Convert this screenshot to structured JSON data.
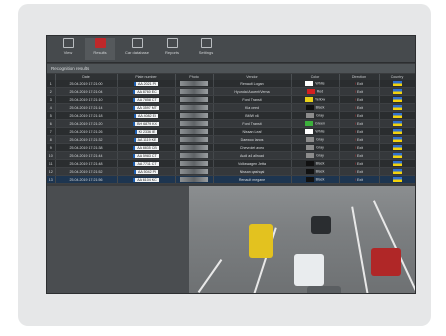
{
  "toolbar": {
    "items": [
      {
        "label": "View",
        "icon": "view-icon"
      },
      {
        "label": "Results",
        "icon": "results-icon",
        "active": true
      },
      {
        "label": "Car database",
        "icon": "car-database-icon"
      },
      {
        "label": "Reports",
        "icon": "reports-icon"
      },
      {
        "label": "Settings",
        "icon": "settings-icon"
      }
    ]
  },
  "panel": {
    "title": "Recognition results"
  },
  "table": {
    "columns": [
      "",
      "Date",
      "Plate number",
      "Photo",
      "Vendor",
      "Color",
      "Direction",
      "Country"
    ],
    "rows": [
      {
        "n": "1",
        "date": "25.04.2019 17:21:00",
        "plate": "AA 2021 PI",
        "vendor": "Renault Logan",
        "color": "White",
        "color_hex": "#ffffff",
        "dir": "Exit"
      },
      {
        "n": "2",
        "date": "25.04.2019 17:21:04",
        "plate": "AA 8760 EC",
        "vendor": "Hyundai Accent/Verna",
        "color": "Red",
        "color_hex": "#d42020",
        "dir": "Exit"
      },
      {
        "n": "3",
        "date": "25.04.2019 17:21:10",
        "plate": "AA 7858 CT",
        "vendor": "Ford Transit",
        "color": "Yellow",
        "color_hex": "#e8d21a",
        "dir": "Exit"
      },
      {
        "n": "4",
        "date": "25.04.2019 17:21:14",
        "plate": "AA 3597 MT",
        "vendor": "Kia ceed",
        "color": "Black",
        "color_hex": "#111111",
        "dir": "Exit"
      },
      {
        "n": "5",
        "date": "25.04.2019 17:21:18",
        "plate": "AA 4082 EI",
        "vendor": "BMW x6",
        "color": "Gray",
        "color_hex": "#8c8c8c",
        "dir": "Exit"
      },
      {
        "n": "6",
        "date": "25.04.2019 17:21:20",
        "plate": "BH 6879 KX",
        "vendor": "Ford Transit",
        "color": "Green",
        "color_hex": "#3cb03c",
        "dir": "Exit"
      },
      {
        "n": "7",
        "date": "25.04.2019 17:21:26",
        "plate": "KI 2336 IE",
        "vendor": "Nissan Leaf",
        "color": "White",
        "color_hex": "#ffffff",
        "dir": "Exit"
      },
      {
        "n": "8",
        "date": "25.04.2019 17:21:32",
        "plate": "AA 1119 KE",
        "vendor": "Daewoo lanos",
        "color": "Gray",
        "color_hex": "#8c8c8c",
        "dir": "Exit"
      },
      {
        "n": "9",
        "date": "25.04.2019 17:21:38",
        "plate": "AA 8835 CB",
        "vendor": "Chevrolet aveo",
        "color": "Gray",
        "color_hex": "#8c8c8c",
        "dir": "Exit"
      },
      {
        "n": "10",
        "date": "25.04.2019 17:21:44",
        "plate": "AA 5983 CT",
        "vendor": "Audi a4 allroad",
        "color": "Gray",
        "color_hex": "#8c8c8c",
        "dir": "Exit"
      },
      {
        "n": "11",
        "date": "25.04.2019 17:21:48",
        "plate": "AA 7711 CT",
        "vendor": "Volkswagen Jetta",
        "color": "Black",
        "color_hex": "#111111",
        "dir": "Exit"
      },
      {
        "n": "12",
        "date": "25.04.2019 17:21:52",
        "plate": "AA 5042 PI",
        "vendor": "Nissan qashqai",
        "color": "Black",
        "color_hex": "#111111",
        "dir": "Exit"
      },
      {
        "n": "13",
        "date": "25.04.2019 17:21:56",
        "plate": "AA 6104 KC",
        "vendor": "Renault megane",
        "color": "Black",
        "color_hex": "#111111",
        "dir": "Exit"
      }
    ]
  }
}
